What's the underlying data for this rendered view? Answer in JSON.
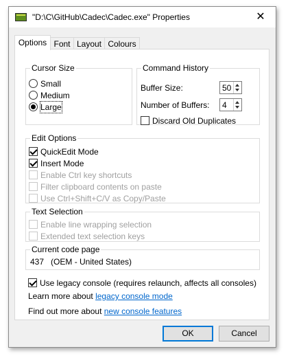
{
  "window": {
    "title": "\"D:\\C\\GitHub\\Cadec\\Cadec.exe\" Properties",
    "close_label": "✕"
  },
  "tabs": [
    {
      "label": "Options"
    },
    {
      "label": "Font"
    },
    {
      "label": "Layout"
    },
    {
      "label": "Colours"
    }
  ],
  "cursor_size": {
    "legend": "Cursor Size",
    "options": [
      {
        "label": "Small",
        "selected": false
      },
      {
        "label": "Medium",
        "selected": false
      },
      {
        "label": "Large",
        "selected": true
      }
    ]
  },
  "command_history": {
    "legend": "Command History",
    "buffer_size_label": "Buffer Size:",
    "buffer_size_value": "50",
    "num_buffers_label": "Number of Buffers:",
    "num_buffers_value": "4",
    "discard_label": "Discard Old Duplicates",
    "discard_checked": false
  },
  "edit_options": {
    "legend": "Edit Options",
    "items": [
      {
        "label": "QuickEdit Mode",
        "checked": true,
        "enabled": true
      },
      {
        "label": "Insert Mode",
        "checked": true,
        "enabled": true
      },
      {
        "label": "Enable Ctrl key shortcuts",
        "checked": false,
        "enabled": false
      },
      {
        "label": "Filter clipboard contents on paste",
        "checked": false,
        "enabled": false
      },
      {
        "label": "Use Ctrl+Shift+C/V as Copy/Paste",
        "checked": false,
        "enabled": false
      }
    ]
  },
  "text_selection": {
    "legend": "Text Selection",
    "items": [
      {
        "label": "Enable line wrapping selection",
        "checked": false,
        "enabled": false
      },
      {
        "label": "Extended text selection keys",
        "checked": false,
        "enabled": false
      }
    ]
  },
  "code_page": {
    "legend": "Current code page",
    "value": "437   (OEM - United States)"
  },
  "legacy": {
    "label": "Use legacy console (requires relaunch, affects all consoles)",
    "checked": true
  },
  "learn_more": {
    "prefix": "Learn more about ",
    "link": "legacy console mode"
  },
  "find_out": {
    "prefix": "Find out more about ",
    "link": "new console features"
  },
  "buttons": {
    "ok": "OK",
    "cancel": "Cancel"
  }
}
